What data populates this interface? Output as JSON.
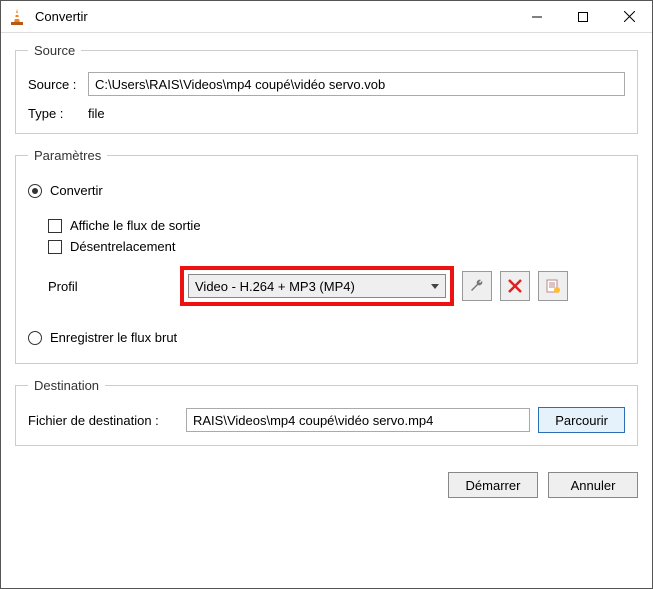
{
  "window": {
    "title": "Convertir"
  },
  "source": {
    "legend": "Source",
    "source_label": "Source :",
    "source_value": "C:\\Users\\RAIS\\Videos\\mp4 coupé\\vidéo servo.vob",
    "type_label": "Type :",
    "type_value": "file"
  },
  "params": {
    "legend": "Paramètres",
    "convert_label": "Convertir",
    "show_output_label": "Affiche le flux de sortie",
    "deinterlace_label": "Désentrelacement",
    "profile_label": "Profil",
    "profile_value": "Video - H.264 + MP3 (MP4)",
    "dump_raw_label": "Enregistrer le flux brut"
  },
  "destination": {
    "legend": "Destination",
    "file_label": "Fichier de destination :",
    "file_value": "RAIS\\Videos\\mp4 coupé\\vidéo servo.mp4",
    "browse_label": "Parcourir"
  },
  "footer": {
    "start_label": "Démarrer",
    "cancel_label": "Annuler"
  }
}
